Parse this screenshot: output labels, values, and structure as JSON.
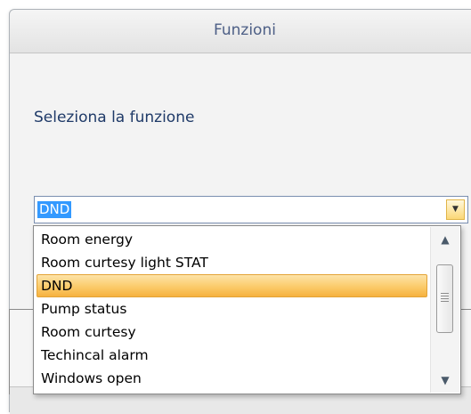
{
  "window": {
    "title": "Funzioni"
  },
  "prompt": "Seleziona la funzione",
  "combo": {
    "value": "DND"
  },
  "dropdown": {
    "options": [
      {
        "label": "Room energy",
        "selected": false
      },
      {
        "label": "Room curtesy light STAT",
        "selected": false
      },
      {
        "label": "DND",
        "selected": true
      },
      {
        "label": "Pump status",
        "selected": false
      },
      {
        "label": "Room curtesy",
        "selected": false
      },
      {
        "label": "Techincal alarm",
        "selected": false
      },
      {
        "label": "Windows open",
        "selected": false
      }
    ]
  },
  "icons": {
    "combo_arrow": "chevron-down-icon",
    "scroll_up": "scroll-up-arrow-icon",
    "scroll_down": "scroll-down-arrow-icon"
  },
  "colors": {
    "selection_highlight": "#3399ff",
    "selected_item": "#fbcb6a",
    "title_text": "#4d5f86"
  }
}
